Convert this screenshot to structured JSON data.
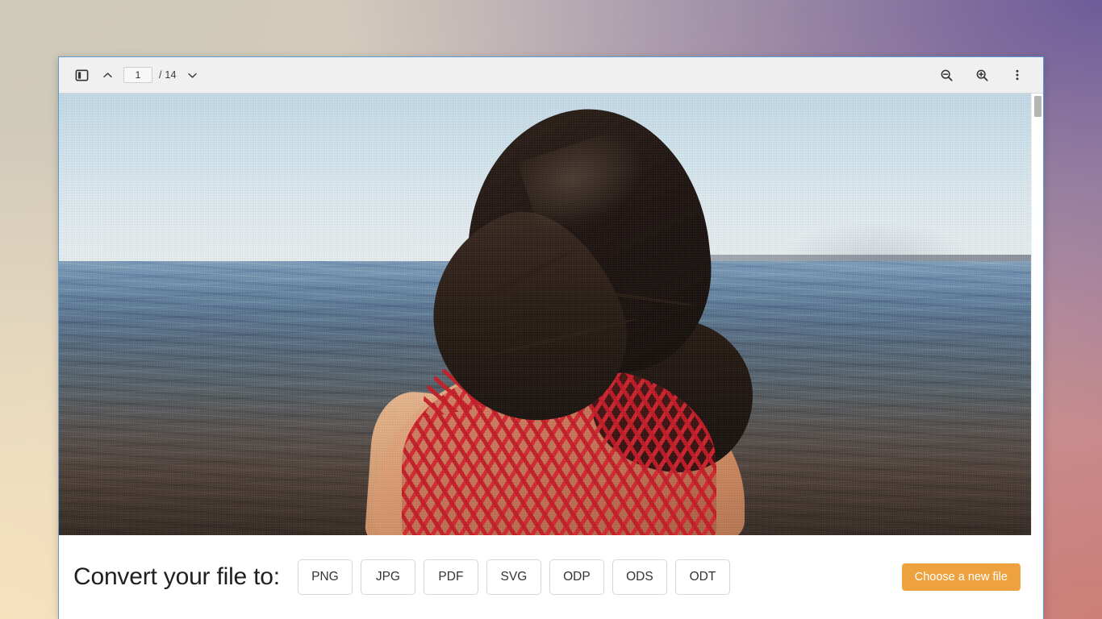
{
  "desktop": {
    "gradient_colors": {
      "top_left": "#cfc9b9",
      "top_right": "#6c5c9a",
      "bottom_left": "#f7e2be",
      "bottom_right": "#cc7f76"
    }
  },
  "window": {
    "border_color": "#5a9bd8"
  },
  "toolbar": {
    "sidebar_toggle_label": "Toggle sidebar",
    "previous_page_label": "Previous page",
    "page_number_value": "1",
    "page_number_placeholder": "1",
    "page_total_label": "/ 14",
    "next_page_label": "Next page",
    "zoom_out_label": "Zoom out",
    "zoom_in_label": "Zoom in",
    "more_options_label": "More options",
    "background_color": "#f0f0f0"
  },
  "viewer": {
    "page_description": "Photograph of a smiling woman with long dark hair wearing a red crochet top, standing in front of the sea at sunset",
    "current_page": "1",
    "total_pages": "14"
  },
  "convert_bar": {
    "label": "Convert your file to:",
    "formats": [
      {
        "label": "PNG"
      },
      {
        "label": "JPG"
      },
      {
        "label": "PDF"
      },
      {
        "label": "SVG"
      },
      {
        "label": "ODP"
      },
      {
        "label": "ODS"
      },
      {
        "label": "ODT"
      }
    ],
    "choose_file_label": "Choose a new file",
    "choose_file_color": "#eda23f"
  }
}
